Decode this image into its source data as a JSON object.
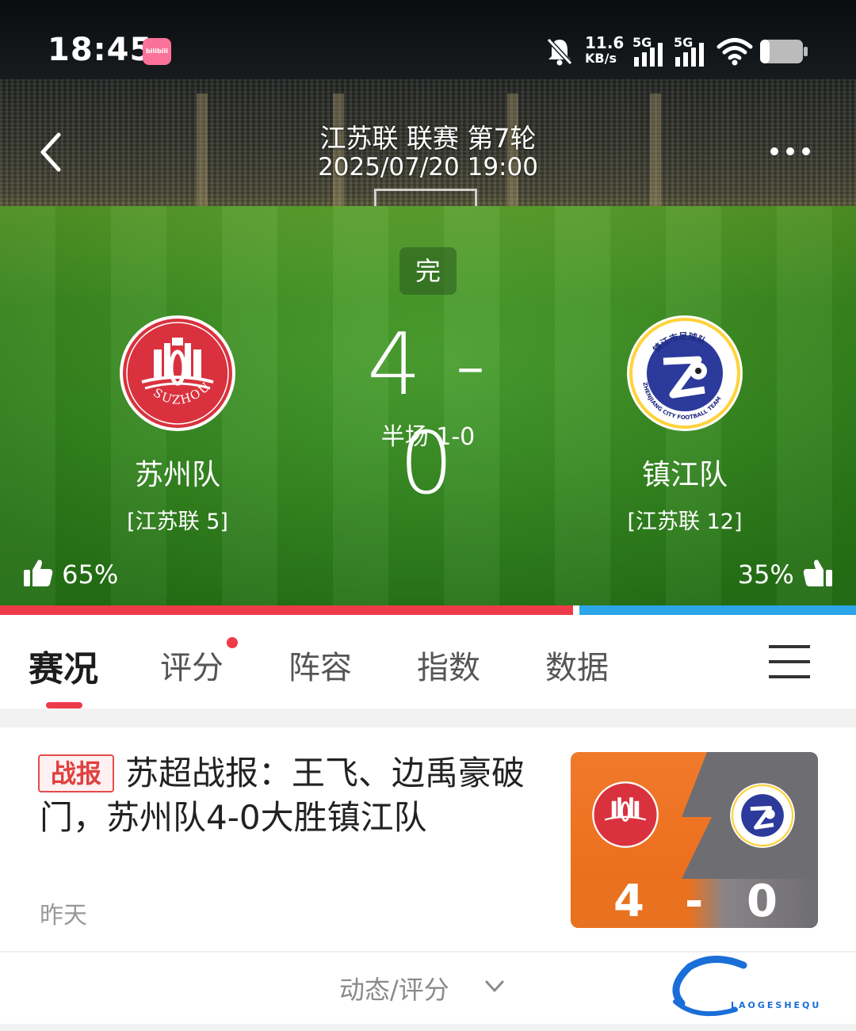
{
  "status_bar": {
    "time": "18:45",
    "app_badge": "bilibili",
    "net_speed_value": "11.6",
    "net_speed_unit": "KB/s",
    "sim1": "5G",
    "sim2": "5G"
  },
  "header": {
    "title": "江苏联 联赛 第7轮",
    "datetime": "2025/07/20 19:00"
  },
  "match": {
    "status": "完",
    "score": "4 - 0",
    "halftime": "半场 1-0",
    "home": {
      "name": "苏州队",
      "rank": "[江苏联 5]",
      "logo_text": "SUZHOU",
      "vote": "65%"
    },
    "away": {
      "name": "镇江队",
      "rank": "[江苏联 12]",
      "logo_text_top": "镇江市足球队",
      "logo_text_bottom": "ZHENJIANG CITY FOOTBALL TEAM",
      "vote": "35%"
    },
    "vote_home_fraction": 0.65,
    "colors": {
      "home": "#ee3b49",
      "away": "#2ba6ea"
    }
  },
  "tabs": [
    {
      "label": "赛况",
      "active": true
    },
    {
      "label": "评分",
      "active": false,
      "dot": true
    },
    {
      "label": "阵容",
      "active": false
    },
    {
      "label": "指数",
      "active": false
    },
    {
      "label": "数据",
      "active": false
    }
  ],
  "news": {
    "tag": "战报",
    "title": "苏超战报：王飞、边禹豪破门，苏州队4-0大胜镇江队",
    "time": "昨天",
    "thumb": {
      "home_score": "4",
      "dash": "-",
      "away_score": "0"
    }
  },
  "footer": {
    "toggle_label": "动态/评分",
    "watermark": "老哥社区",
    "watermark_sub": "LAOGESHEQU"
  }
}
